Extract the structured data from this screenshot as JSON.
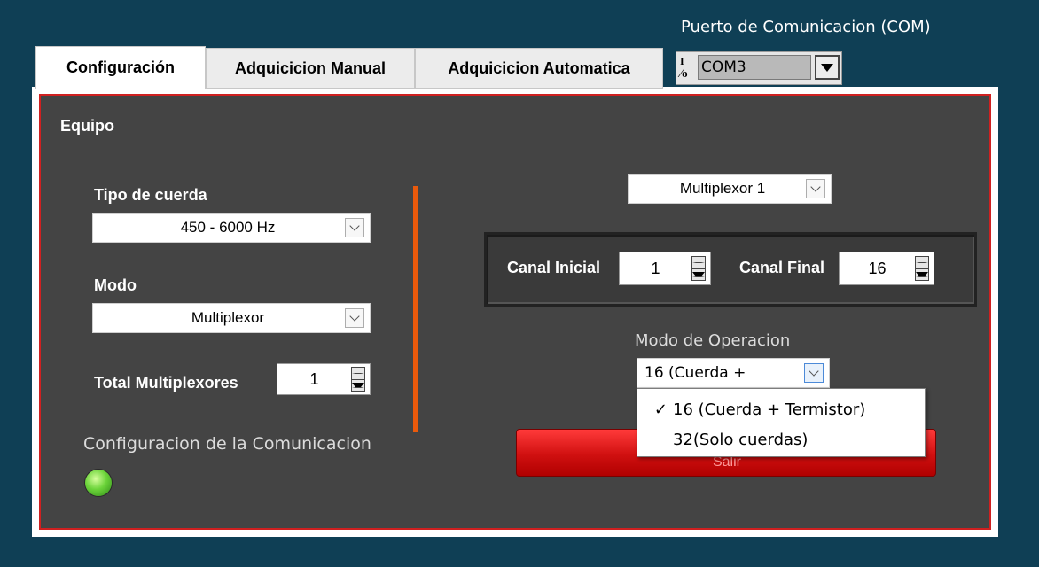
{
  "com": {
    "title": "Puerto de Comunicacion (COM)",
    "io_glyph": "I/O",
    "io_top": "I",
    "io_bottom": "⁄o",
    "value": "COM3"
  },
  "tabs": [
    {
      "label": "Configuración",
      "active": true
    },
    {
      "label": "Adquicicion Manual",
      "active": false
    },
    {
      "label": "Adquicicion Automatica",
      "active": false
    }
  ],
  "panel": {
    "section_title": "Equipo",
    "tipo_cuerda": {
      "label": "Tipo de cuerda",
      "value": "450 - 6000 Hz"
    },
    "modo": {
      "label": "Modo",
      "value": "Multiplexor"
    },
    "total_multiplexores": {
      "label": "Total Multiplexores",
      "value": "1"
    },
    "comm_config": {
      "label": "Configuracion de la Comunicacion",
      "led_color": "#6cd43a"
    },
    "multiplexor_select": {
      "value": "Multiplexor 1"
    },
    "canal_inicial": {
      "label": "Canal Inicial",
      "value": "1"
    },
    "canal_final": {
      "label": "Canal Final",
      "value": "16"
    },
    "modo_operacion": {
      "label": "Modo de Operacion",
      "value": "16 (Cuerda +",
      "options": [
        {
          "label": "16 (Cuerda + Termistor)",
          "checked": true,
          "check_mark": "✓"
        },
        {
          "label": "32(Solo cuerdas)",
          "checked": false,
          "check_mark": ""
        }
      ]
    },
    "red_button": {
      "label": "Salir",
      "color": "#d01010"
    }
  },
  "colors": {
    "background": "#0f3f55",
    "panel": "#444444",
    "panel_border": "#d02020",
    "divider": "#ea5a0c"
  }
}
